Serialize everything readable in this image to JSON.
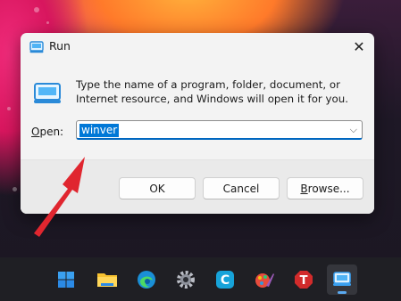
{
  "dialog": {
    "title": "Run",
    "description": "Type the name of a program, folder, document, or Internet resource, and Windows will open it for you.",
    "open_label_underlined": "O",
    "open_label_rest": "pen:",
    "input_value": "winver",
    "ok_label": "OK",
    "cancel_label": "Cancel",
    "browse_label_underlined": "B",
    "browse_label_rest": "rowse..."
  },
  "taskbar": {
    "items": [
      "windows-start-icon",
      "file-explorer-icon",
      "edge-icon",
      "settings-icon",
      "c-app-icon",
      "paint-app-icon",
      "t-app-icon",
      "run-app-icon"
    ],
    "active_item": "run-app-icon"
  },
  "colors": {
    "accent": "#0067c0",
    "selection": "#0078d7",
    "annotation_arrow": "#e0262f"
  }
}
